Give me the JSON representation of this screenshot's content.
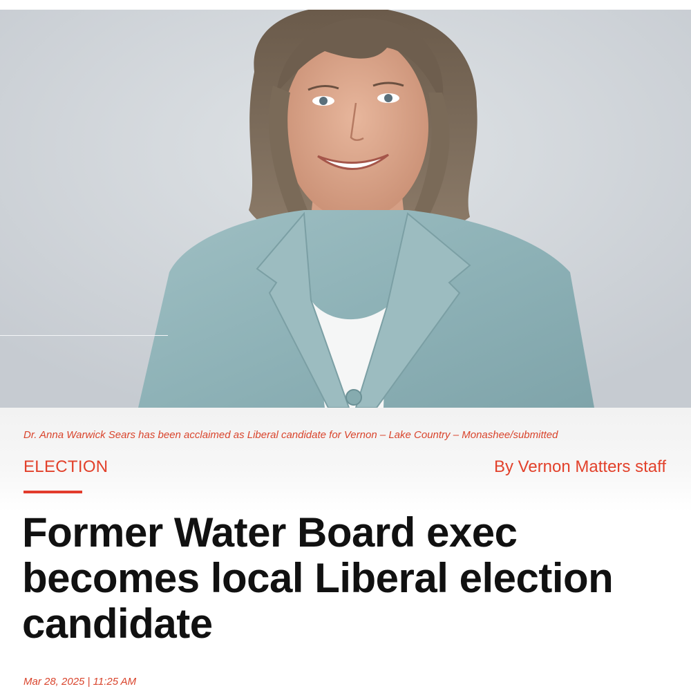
{
  "hero": {
    "image_icon": "portrait-photo"
  },
  "article": {
    "caption": "Dr. Anna Warwick Sears has been acclaimed as Liberal candidate for Vernon – Lake Country – Monashee/submitted",
    "category": "ELECTION",
    "byline": "By Vernon Matters staff",
    "headline": "Former Water Board exec becomes local Liberal election candidate",
    "dateline": "Mar 28, 2025 | 11:25 AM"
  },
  "colors": {
    "accent": "#e2412b",
    "headline": "#111111"
  }
}
